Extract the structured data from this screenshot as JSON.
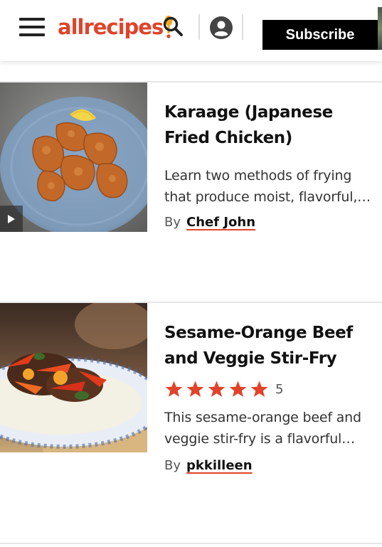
{
  "header": {
    "logo_text": "allrecipes",
    "subscribe_label": "Subscribe",
    "brand_color": "#e0432b"
  },
  "icons": {
    "menu": "hamburger-menu-icon",
    "search": "search-icon",
    "account": "account-icon",
    "play": "play-icon",
    "star": "star-icon"
  },
  "cards": [
    {
      "title": "Karaage (Japanese Fried Chicken)",
      "description": "Learn two methods of frying that produce moist, flavorful,…",
      "by_label": "By",
      "author": "Chef John",
      "has_video": true
    },
    {
      "title": "Sesame-Orange Beef and Veggie Stir-Fry",
      "description": "This sesame-orange beef and veggie stir-fry is a flavorful…",
      "by_label": "By",
      "author": "pkkilleen",
      "rating": 5,
      "rating_count": "5"
    }
  ]
}
